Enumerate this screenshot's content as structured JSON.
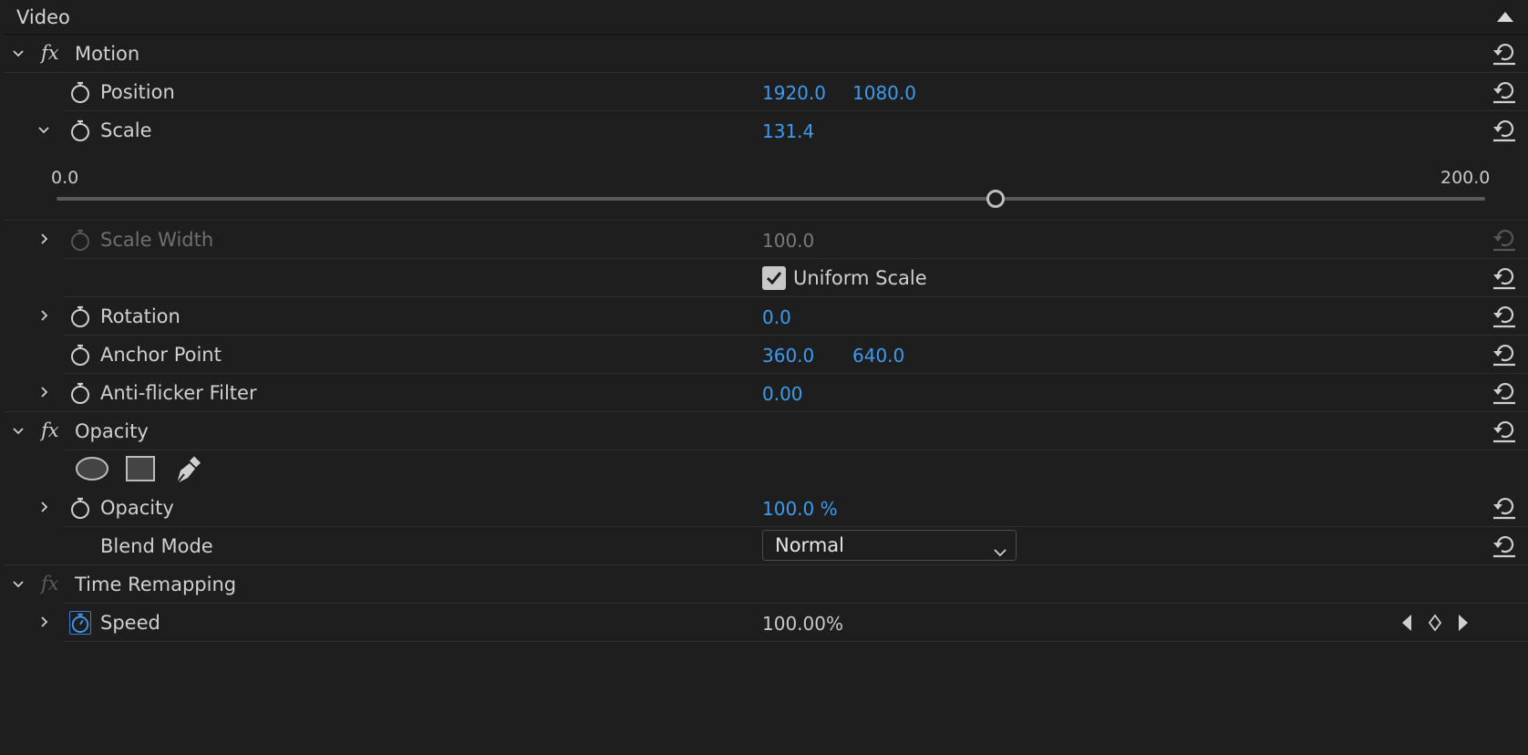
{
  "panel": {
    "section_title": "Video"
  },
  "motion": {
    "title": "Motion",
    "position": {
      "label": "Position",
      "x": "1920.0",
      "y": "1080.0"
    },
    "scale": {
      "label": "Scale",
      "value": "131.4",
      "slider": {
        "min_label": "0.0",
        "max_label": "200.0",
        "min": 0,
        "max": 200,
        "value": 131.4
      }
    },
    "scale_width": {
      "label": "Scale Width",
      "value": "100.0"
    },
    "uniform_scale": {
      "label": "Uniform Scale",
      "checked": true
    },
    "rotation": {
      "label": "Rotation",
      "value": "0.0"
    },
    "anchor_point": {
      "label": "Anchor Point",
      "x": "360.0",
      "y": "640.0"
    },
    "anti_flicker": {
      "label": "Anti-flicker Filter",
      "value": "0.00"
    }
  },
  "opacity_effect": {
    "title": "Opacity",
    "mask_tools": [
      "ellipse-mask-icon",
      "rectangle-mask-icon",
      "pen-mask-icon"
    ],
    "opacity": {
      "label": "Opacity",
      "value": "100.0 %"
    },
    "blend_mode": {
      "label": "Blend Mode",
      "value": "Normal"
    }
  },
  "time_remapping": {
    "title": "Time Remapping",
    "speed": {
      "label": "Speed",
      "value": "100.00%"
    }
  },
  "colors": {
    "background": "#1e1e1e",
    "value_blue": "#3c9bf0",
    "text": "#d0d0d0",
    "dim_text": "#6f6f6f"
  }
}
